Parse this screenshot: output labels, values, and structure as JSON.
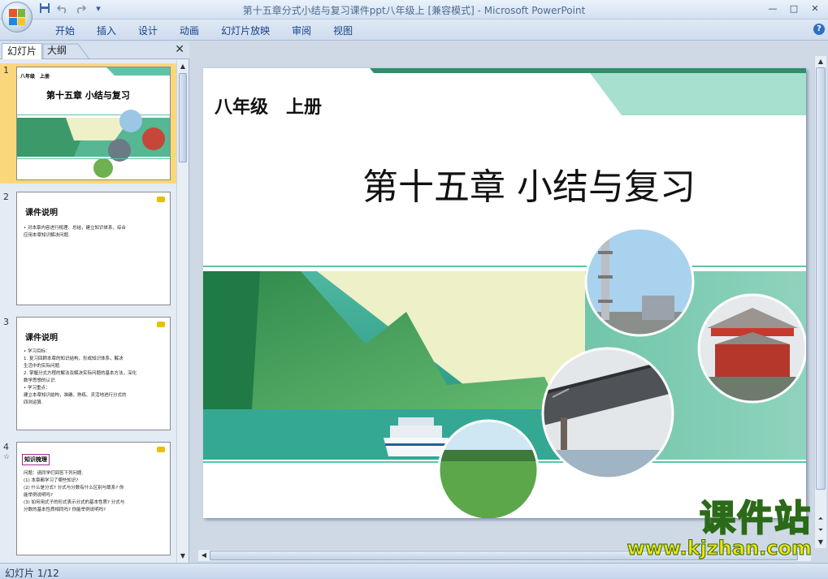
{
  "window": {
    "title": "第十五章分式小结与复习课件ppt八年级上 [兼容模式] - Microsoft PowerPoint"
  },
  "qat": {
    "save_icon": "save-icon",
    "undo_icon": "undo-icon",
    "redo_icon": "redo-icon",
    "customize_icon": "customize-icon"
  },
  "ribbon": {
    "tabs": [
      "开始",
      "插入",
      "设计",
      "动画",
      "幻灯片放映",
      "审阅",
      "视图"
    ]
  },
  "leftpane": {
    "tab_slides": "幻灯片",
    "tab_outline": "大纲",
    "thumbnails": [
      {
        "num": "1",
        "grade": "八年级　上册",
        "title": "第十五章 小结与复习"
      },
      {
        "num": "2",
        "title": "课件说明",
        "lines": [
          "• 对本章内容进行梳理、总结，建立知识体系，综合",
          "  应用本章知识解决问题."
        ]
      },
      {
        "num": "3",
        "title": "课件说明",
        "lines": [
          "• 学习目标：",
          "  1. 复习回顾本章的知识结构，形成知识体系，解决",
          "     生活中的实际问题.",
          "  2. 掌握分式方程的解法及解决实际问题的基本方法，深化",
          "     数学思想的认识.",
          "• 学习重点：",
          "  建立本章知识结构，准确、熟练、灵活地进行分式的",
          "  四则运算."
        ]
      },
      {
        "num": "4",
        "title": "知识梳理",
        "lines": [
          "问题：请同学们回答下列问题.",
          "(1) 本章都学习了哪些知识?",
          "(2) 什么是分式? 分式与分数有什么区别与联系? 你",
          "     能举例说明吗?",
          "(3) 如何用式子的形式表示分式的基本性质? 分式与",
          "     分数的基本性质相同吗? 你能举例说明吗?"
        ]
      }
    ]
  },
  "slide": {
    "grade": "八年级　上册",
    "title": "第十五章  小结与复习"
  },
  "status": {
    "text": "幻灯片 1/12"
  },
  "watermark": {
    "main": "课件站",
    "url": "www.kjzhan.com"
  },
  "colors": {
    "teal": "#5fc4a5",
    "light_teal": "#a8e0cf",
    "accent_green": "#2e8f6b",
    "selected": "#fbd77c"
  }
}
